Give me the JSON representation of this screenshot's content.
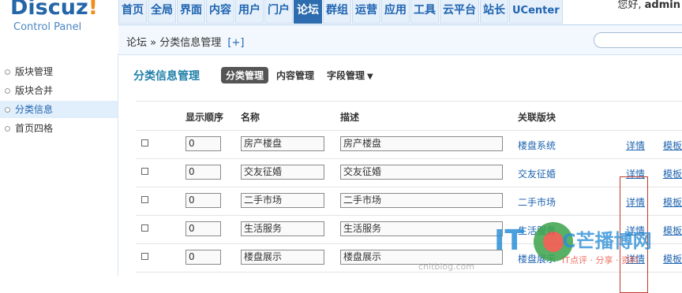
{
  "app": {
    "logo_text": "Discuz",
    "logo_mark": "!",
    "logo_subtitle": "Control Panel"
  },
  "user": {
    "greeting": "您好,",
    "name": "admin"
  },
  "nav": {
    "items": [
      {
        "label": "首页"
      },
      {
        "label": "全局"
      },
      {
        "label": "界面"
      },
      {
        "label": "内容"
      },
      {
        "label": "用户"
      },
      {
        "label": "门户"
      },
      {
        "label": "论坛"
      },
      {
        "label": "群组"
      },
      {
        "label": "运营"
      },
      {
        "label": "应用"
      },
      {
        "label": "工具"
      },
      {
        "label": "云平台"
      },
      {
        "label": "站长"
      },
      {
        "label": "UCenter"
      }
    ],
    "active": "论坛"
  },
  "breadcrumb": {
    "root": "论坛",
    "separator": "»",
    "current": "分类信息管理",
    "add_label": "[+]"
  },
  "sidebar": {
    "items": [
      {
        "label": "版块管理"
      },
      {
        "label": "版块合并"
      },
      {
        "label": "分类信息"
      },
      {
        "label": "首页四格"
      }
    ],
    "active": "分类信息"
  },
  "page": {
    "title": "分类信息管理",
    "tabs": [
      {
        "label": "分类管理"
      },
      {
        "label": "内容管理"
      },
      {
        "label": "字段管理"
      }
    ],
    "tab_caret": "▼"
  },
  "table": {
    "headers": {
      "order": "显示顺序",
      "name": "名称",
      "description": "描述",
      "forum": "关联版块"
    },
    "rows": [
      {
        "order": "0",
        "name": "房产楼盘",
        "description": "房产楼盘",
        "forum": "楼盘系统",
        "detail": "详情",
        "template": "模板"
      },
      {
        "order": "0",
        "name": "交友征婚",
        "description": "交友征婚",
        "forum": "交友征婚",
        "detail": "详情",
        "template": "模板"
      },
      {
        "order": "0",
        "name": "二手市场",
        "description": "二手市场",
        "forum": "二手市场",
        "detail": "详情",
        "template": "模板"
      },
      {
        "order": "0",
        "name": "生活服务",
        "description": "生活服务",
        "forum": "生活服务",
        "detail": "详情",
        "template": "模板"
      },
      {
        "order": "0",
        "name": "楼盘展示",
        "description": "楼盘展示",
        "forum": "楼盘展示",
        "detail": "详情",
        "template": "模板"
      }
    ]
  },
  "watermark": {
    "brand": "IT",
    "text": "C芒播博网",
    "slogan": "IT点评 · 分享 · 资料",
    "site": "cnitblog.com"
  },
  "colors": {
    "accent": "#1f64b0",
    "active_nav": "#2d6cae",
    "title": "#1f7fa8",
    "highlight": "#c0392b"
  }
}
